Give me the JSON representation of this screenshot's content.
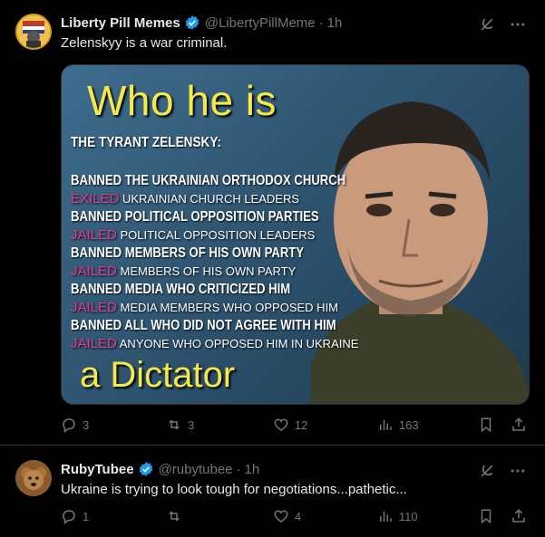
{
  "posts": [
    {
      "display_name": "Liberty Pill Memes",
      "handle": "@LibertyPillMeme",
      "separator": "·",
      "time": "1h",
      "text": "Zelenskyy is a war criminal.",
      "media": {
        "title": "Who he is",
        "subtitle": "THE TYRANT ZELENSKY:",
        "lines": [
          {
            "kw": "BANNED",
            "rest": "THE UKRAINIAN ORTHODOX CHURCH",
            "style": "big"
          },
          {
            "kw": "EXILED",
            "rest": "UKRAINIAN CHURCH LEADERS",
            "style": "small"
          },
          {
            "kw": "BANNED",
            "rest": "POLITICAL OPPOSITION PARTIES",
            "style": "big"
          },
          {
            "kw": "JAILED",
            "rest": "POLITICAL OPPOSITION LEADERS",
            "style": "small"
          },
          {
            "kw": "BANNED",
            "rest": "MEMBERS OF HIS OWN PARTY",
            "style": "big"
          },
          {
            "kw": "JAILED",
            "rest": "MEMBERS OF HIS OWN PARTY",
            "style": "small"
          },
          {
            "kw": "BANNED",
            "rest": "MEDIA WHO CRITICIZED HIM",
            "style": "big"
          },
          {
            "kw": "JAILED",
            "rest": "MEDIA MEMBERS WHO OPPOSED HIM",
            "style": "small"
          },
          {
            "kw": "BANNED",
            "rest": "ALL WHO DID NOT AGREE WITH HIM",
            "style": "big"
          },
          {
            "kw": "JAILED",
            "rest": "ANYONE WHO OPPOSED HIM IN UKRAINE",
            "style": "small"
          }
        ],
        "footer": "a Dictator"
      },
      "actions": {
        "replies": "3",
        "reposts": "3",
        "likes": "12",
        "views": "163"
      }
    },
    {
      "display_name": "RubyTubee",
      "handle": "@rubytubee",
      "separator": "·",
      "time": "1h",
      "text": "Ukraine is trying to look tough for negotiations...pathetic...",
      "actions": {
        "replies": "1",
        "reposts": "",
        "likes": "4",
        "views": "110"
      }
    }
  ],
  "icons": {
    "verified": "verified-badge-icon",
    "grok": "grok-icon",
    "more": "more-icon",
    "reply": "reply-icon",
    "repost": "repost-icon",
    "like": "heart-icon",
    "views": "views-icon",
    "bookmark": "bookmark-icon",
    "share": "share-icon"
  },
  "colors": {
    "background": "#000000",
    "text": "#e7e9ea",
    "muted": "#71767b",
    "verified": "#1d9bf0",
    "meme_yellow": "#f5e94a",
    "meme_pink": "#e83b8d"
  }
}
